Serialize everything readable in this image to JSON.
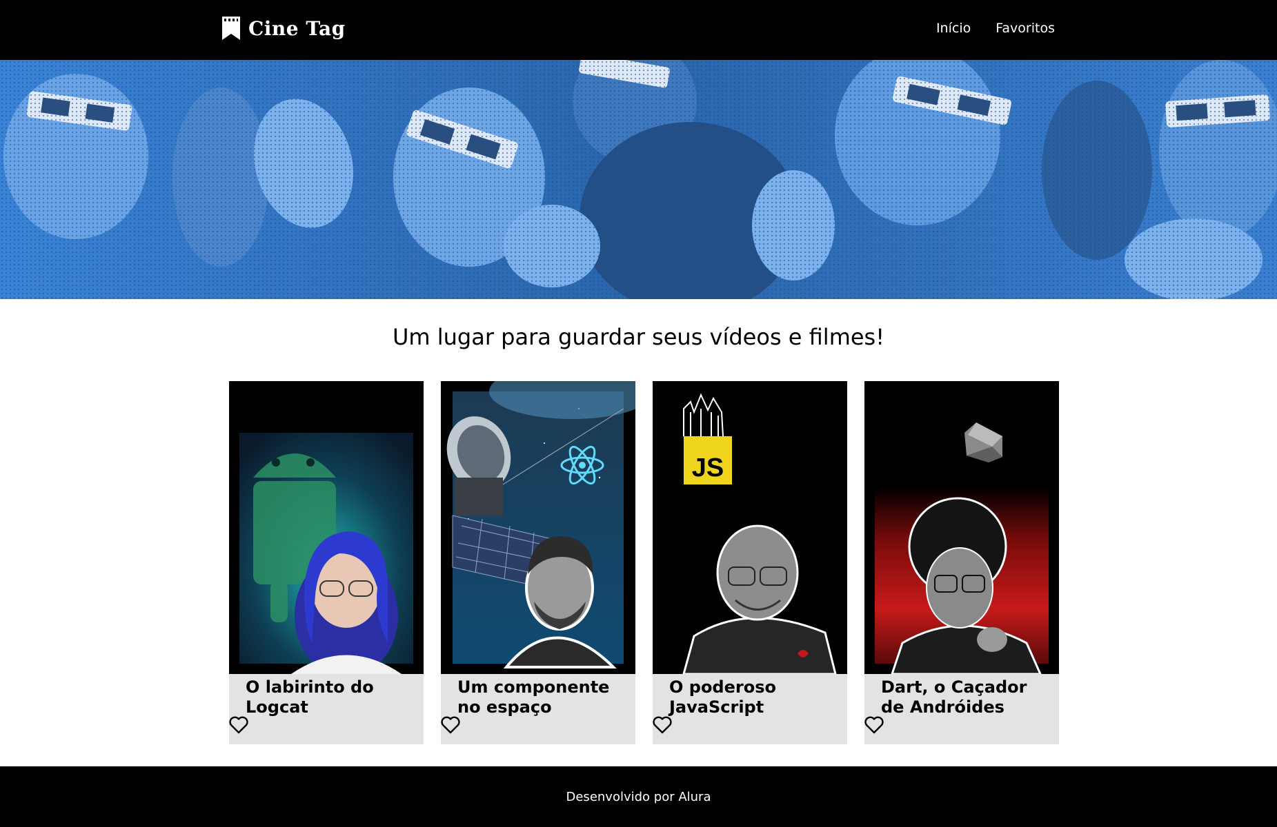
{
  "header": {
    "logo_text": "Cine Tag",
    "nav": [
      {
        "label": "Início"
      },
      {
        "label": "Favoritos"
      }
    ]
  },
  "main": {
    "tagline": "Um lugar para guardar seus vídeos e filmes!",
    "cards": [
      {
        "title": "O labirinto do Logcat",
        "thumbnail_theme": "android",
        "favorited": false
      },
      {
        "title": "Um componente no espaço",
        "thumbnail_theme": "react-satellite",
        "favorited": false
      },
      {
        "title": "O poderoso JavaScript",
        "thumbnail_theme": "javascript",
        "badge": "JS",
        "favorited": false
      },
      {
        "title": "Dart, o Caçador de Andróides",
        "thumbnail_theme": "dart",
        "favorited": false
      }
    ]
  },
  "footer": {
    "text": "Desenvolvido por Alura"
  },
  "colors": {
    "header_bg": "#000000",
    "banner_tint": "#2f6fb8",
    "card_bg": "#e3e3e3",
    "js_yellow": "#f0d51f",
    "react_cyan": "#61dafb"
  }
}
